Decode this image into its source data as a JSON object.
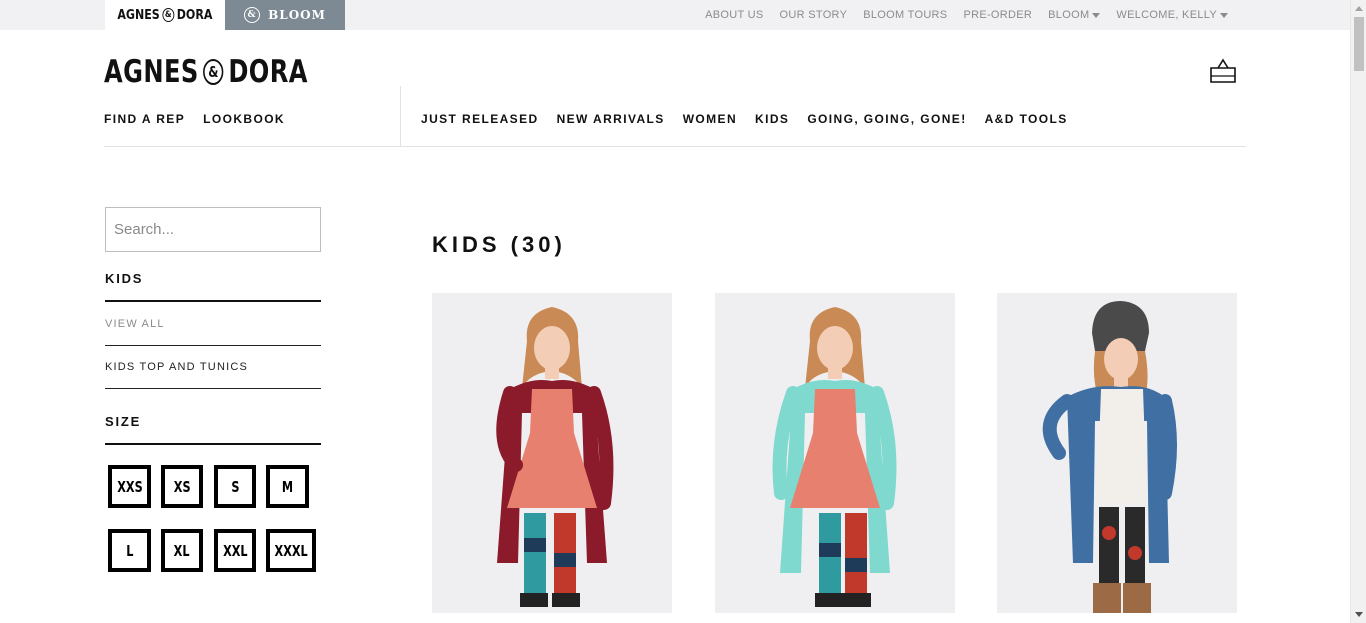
{
  "topbar": {
    "brand_agnes": "AGNES",
    "brand_dora": "DORA",
    "brand_bloom": "BLOOM",
    "links": [
      "ABOUT US",
      "OUR STORY",
      "BLOOM TOURS",
      "PRE-ORDER",
      "BLOOM",
      "WELCOME, KELLY"
    ]
  },
  "header": {
    "logo_left": "AGNES",
    "logo_amp": "&",
    "logo_right": "DORA",
    "left_nav": [
      "FIND A REP",
      "LOOKBOOK"
    ],
    "main_nav": [
      "JUST RELEASED",
      "NEW ARRIVALS",
      "WOMEN",
      "KIDS",
      "GOING, GOING, GONE!",
      "A&D TOOLS"
    ]
  },
  "sidebar": {
    "search_placeholder": "Search...",
    "category_heading": "KIDS",
    "category_links": [
      "VIEW ALL",
      "KIDS TOP AND TUNICS"
    ],
    "size_heading": "SIZE",
    "sizes": [
      "XXS",
      "XS",
      "S",
      "M",
      "L",
      "XL",
      "XXL",
      "XXXL"
    ]
  },
  "main": {
    "heading": "KIDS (30)",
    "products": [
      {
        "cardigan_color": "#8b1a2b",
        "top_color": "#e8806f",
        "hat": false
      },
      {
        "cardigan_color": "#7fd9cf",
        "top_color": "#e8806f",
        "hat": false
      },
      {
        "cardigan_color": "#3f6fa3",
        "top_color": "#f2efea",
        "hat": true
      }
    ]
  },
  "colors": {
    "bloom_tab": "#7d8a93",
    "topbar_bg": "#f1f1f3",
    "util_text": "#8b8b8b"
  }
}
